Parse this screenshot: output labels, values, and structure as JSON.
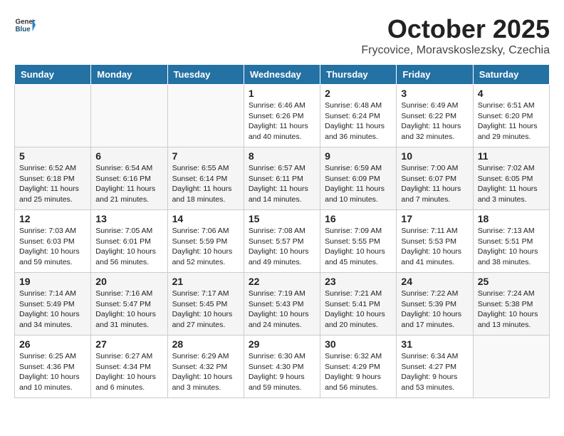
{
  "header": {
    "logo_general": "General",
    "logo_blue": "Blue",
    "month": "October 2025",
    "location": "Frycovice, Moravskoslezsky, Czechia"
  },
  "weekdays": [
    "Sunday",
    "Monday",
    "Tuesday",
    "Wednesday",
    "Thursday",
    "Friday",
    "Saturday"
  ],
  "weeks": [
    [
      {
        "day": "",
        "sunrise": "",
        "sunset": "",
        "daylight": ""
      },
      {
        "day": "",
        "sunrise": "",
        "sunset": "",
        "daylight": ""
      },
      {
        "day": "",
        "sunrise": "",
        "sunset": "",
        "daylight": ""
      },
      {
        "day": "1",
        "sunrise": "Sunrise: 6:46 AM",
        "sunset": "Sunset: 6:26 PM",
        "daylight": "Daylight: 11 hours and 40 minutes."
      },
      {
        "day": "2",
        "sunrise": "Sunrise: 6:48 AM",
        "sunset": "Sunset: 6:24 PM",
        "daylight": "Daylight: 11 hours and 36 minutes."
      },
      {
        "day": "3",
        "sunrise": "Sunrise: 6:49 AM",
        "sunset": "Sunset: 6:22 PM",
        "daylight": "Daylight: 11 hours and 32 minutes."
      },
      {
        "day": "4",
        "sunrise": "Sunrise: 6:51 AM",
        "sunset": "Sunset: 6:20 PM",
        "daylight": "Daylight: 11 hours and 29 minutes."
      }
    ],
    [
      {
        "day": "5",
        "sunrise": "Sunrise: 6:52 AM",
        "sunset": "Sunset: 6:18 PM",
        "daylight": "Daylight: 11 hours and 25 minutes."
      },
      {
        "day": "6",
        "sunrise": "Sunrise: 6:54 AM",
        "sunset": "Sunset: 6:16 PM",
        "daylight": "Daylight: 11 hours and 21 minutes."
      },
      {
        "day": "7",
        "sunrise": "Sunrise: 6:55 AM",
        "sunset": "Sunset: 6:14 PM",
        "daylight": "Daylight: 11 hours and 18 minutes."
      },
      {
        "day": "8",
        "sunrise": "Sunrise: 6:57 AM",
        "sunset": "Sunset: 6:11 PM",
        "daylight": "Daylight: 11 hours and 14 minutes."
      },
      {
        "day": "9",
        "sunrise": "Sunrise: 6:59 AM",
        "sunset": "Sunset: 6:09 PM",
        "daylight": "Daylight: 11 hours and 10 minutes."
      },
      {
        "day": "10",
        "sunrise": "Sunrise: 7:00 AM",
        "sunset": "Sunset: 6:07 PM",
        "daylight": "Daylight: 11 hours and 7 minutes."
      },
      {
        "day": "11",
        "sunrise": "Sunrise: 7:02 AM",
        "sunset": "Sunset: 6:05 PM",
        "daylight": "Daylight: 11 hours and 3 minutes."
      }
    ],
    [
      {
        "day": "12",
        "sunrise": "Sunrise: 7:03 AM",
        "sunset": "Sunset: 6:03 PM",
        "daylight": "Daylight: 10 hours and 59 minutes."
      },
      {
        "day": "13",
        "sunrise": "Sunrise: 7:05 AM",
        "sunset": "Sunset: 6:01 PM",
        "daylight": "Daylight: 10 hours and 56 minutes."
      },
      {
        "day": "14",
        "sunrise": "Sunrise: 7:06 AM",
        "sunset": "Sunset: 5:59 PM",
        "daylight": "Daylight: 10 hours and 52 minutes."
      },
      {
        "day": "15",
        "sunrise": "Sunrise: 7:08 AM",
        "sunset": "Sunset: 5:57 PM",
        "daylight": "Daylight: 10 hours and 49 minutes."
      },
      {
        "day": "16",
        "sunrise": "Sunrise: 7:09 AM",
        "sunset": "Sunset: 5:55 PM",
        "daylight": "Daylight: 10 hours and 45 minutes."
      },
      {
        "day": "17",
        "sunrise": "Sunrise: 7:11 AM",
        "sunset": "Sunset: 5:53 PM",
        "daylight": "Daylight: 10 hours and 41 minutes."
      },
      {
        "day": "18",
        "sunrise": "Sunrise: 7:13 AM",
        "sunset": "Sunset: 5:51 PM",
        "daylight": "Daylight: 10 hours and 38 minutes."
      }
    ],
    [
      {
        "day": "19",
        "sunrise": "Sunrise: 7:14 AM",
        "sunset": "Sunset: 5:49 PM",
        "daylight": "Daylight: 10 hours and 34 minutes."
      },
      {
        "day": "20",
        "sunrise": "Sunrise: 7:16 AM",
        "sunset": "Sunset: 5:47 PM",
        "daylight": "Daylight: 10 hours and 31 minutes."
      },
      {
        "day": "21",
        "sunrise": "Sunrise: 7:17 AM",
        "sunset": "Sunset: 5:45 PM",
        "daylight": "Daylight: 10 hours and 27 minutes."
      },
      {
        "day": "22",
        "sunrise": "Sunrise: 7:19 AM",
        "sunset": "Sunset: 5:43 PM",
        "daylight": "Daylight: 10 hours and 24 minutes."
      },
      {
        "day": "23",
        "sunrise": "Sunrise: 7:21 AM",
        "sunset": "Sunset: 5:41 PM",
        "daylight": "Daylight: 10 hours and 20 minutes."
      },
      {
        "day": "24",
        "sunrise": "Sunrise: 7:22 AM",
        "sunset": "Sunset: 5:39 PM",
        "daylight": "Daylight: 10 hours and 17 minutes."
      },
      {
        "day": "25",
        "sunrise": "Sunrise: 7:24 AM",
        "sunset": "Sunset: 5:38 PM",
        "daylight": "Daylight: 10 hours and 13 minutes."
      }
    ],
    [
      {
        "day": "26",
        "sunrise": "Sunrise: 6:25 AM",
        "sunset": "Sunset: 4:36 PM",
        "daylight": "Daylight: 10 hours and 10 minutes."
      },
      {
        "day": "27",
        "sunrise": "Sunrise: 6:27 AM",
        "sunset": "Sunset: 4:34 PM",
        "daylight": "Daylight: 10 hours and 6 minutes."
      },
      {
        "day": "28",
        "sunrise": "Sunrise: 6:29 AM",
        "sunset": "Sunset: 4:32 PM",
        "daylight": "Daylight: 10 hours and 3 minutes."
      },
      {
        "day": "29",
        "sunrise": "Sunrise: 6:30 AM",
        "sunset": "Sunset: 4:30 PM",
        "daylight": "Daylight: 9 hours and 59 minutes."
      },
      {
        "day": "30",
        "sunrise": "Sunrise: 6:32 AM",
        "sunset": "Sunset: 4:29 PM",
        "daylight": "Daylight: 9 hours and 56 minutes."
      },
      {
        "day": "31",
        "sunrise": "Sunrise: 6:34 AM",
        "sunset": "Sunset: 4:27 PM",
        "daylight": "Daylight: 9 hours and 53 minutes."
      },
      {
        "day": "",
        "sunrise": "",
        "sunset": "",
        "daylight": ""
      }
    ]
  ]
}
